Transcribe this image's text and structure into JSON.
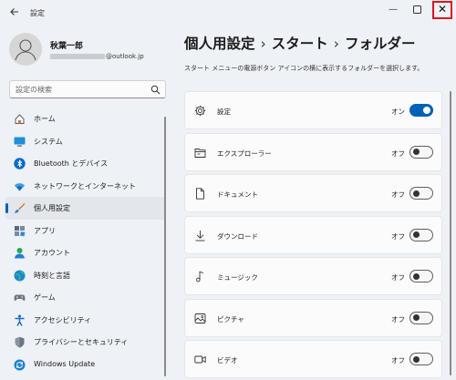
{
  "window": {
    "title": "設定",
    "back_icon": "back-arrow-icon",
    "minimize_glyph": "—",
    "maximize_glyph": "☐",
    "close_glyph": "✕",
    "close_highlight_color": "#e0141e"
  },
  "profile": {
    "name": "秋葉一郎",
    "email_suffix": "@outlook.jp"
  },
  "search": {
    "placeholder": "設定の検索"
  },
  "sidebar": {
    "items": [
      {
        "label": "ホーム",
        "icon": "home-icon"
      },
      {
        "label": "システム",
        "icon": "system-icon"
      },
      {
        "label": "Bluetooth とデバイス",
        "icon": "bluetooth-icon"
      },
      {
        "label": "ネットワークとインターネット",
        "icon": "wifi-icon"
      },
      {
        "label": "個人用設定",
        "icon": "brush-icon",
        "active": true
      },
      {
        "label": "アプリ",
        "icon": "apps-icon"
      },
      {
        "label": "アカウント",
        "icon": "account-icon"
      },
      {
        "label": "時刻と言語",
        "icon": "time-language-icon"
      },
      {
        "label": "ゲーム",
        "icon": "gaming-icon"
      },
      {
        "label": "アクセシビリティ",
        "icon": "accessibility-icon"
      },
      {
        "label": "プライバシーとセキュリティ",
        "icon": "shield-icon"
      },
      {
        "label": "Windows Update",
        "icon": "windows-update-icon"
      }
    ]
  },
  "breadcrumb": {
    "part1": "個人用設定",
    "part2": "スタート",
    "part3": "フォルダー",
    "separator": "›"
  },
  "description": "スタート メニューの電源ボタン アイコンの横に表示するフォルダーを選択します。",
  "folders": [
    {
      "label": "設定",
      "state": "オン",
      "on": true,
      "icon": "gear-icon"
    },
    {
      "label": "エクスプローラー",
      "state": "オフ",
      "on": false,
      "icon": "file-explorer-icon"
    },
    {
      "label": "ドキュメント",
      "state": "オフ",
      "on": false,
      "icon": "document-icon"
    },
    {
      "label": "ダウンロード",
      "state": "オフ",
      "on": false,
      "icon": "download-icon"
    },
    {
      "label": "ミュージック",
      "state": "オフ",
      "on": false,
      "icon": "music-icon"
    },
    {
      "label": "ピクチャ",
      "state": "オフ",
      "on": false,
      "icon": "picture-icon"
    },
    {
      "label": "ビデオ",
      "state": "オフ",
      "on": false,
      "icon": "video-icon"
    }
  ],
  "colors": {
    "accent": "#005fb8",
    "background": "#eef1f6",
    "card": "#fbfbfb"
  }
}
